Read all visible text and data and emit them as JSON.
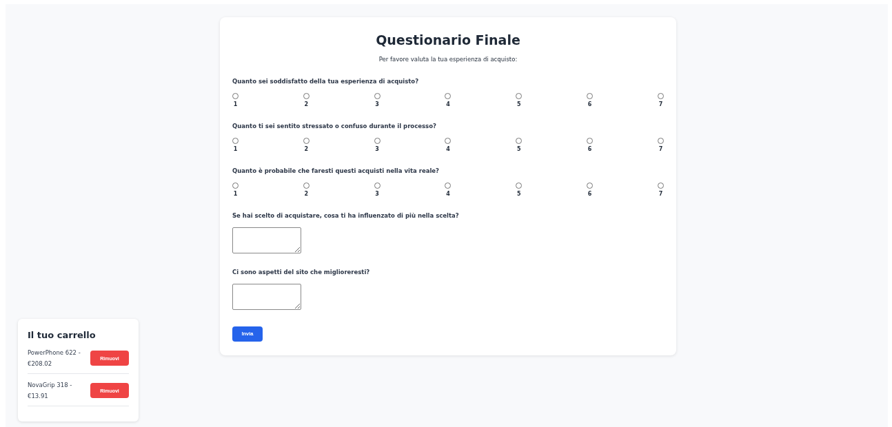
{
  "survey": {
    "title": "Questionario Finale",
    "intro": "Per favore valuta la tua esperienza di acquisto:",
    "questions": [
      {
        "kind": "scale",
        "label": "Quanto sei soddisfatto della tua esperienza di acquisto?",
        "options": [
          {
            "label": "1",
            "selected": false
          },
          {
            "label": "2",
            "selected": false
          },
          {
            "label": "3",
            "selected": false
          },
          {
            "label": "4",
            "selected": false
          },
          {
            "label": "5",
            "selected": false
          },
          {
            "label": "6",
            "selected": false
          },
          {
            "label": "7",
            "selected": false
          }
        ]
      },
      {
        "kind": "scale",
        "label": "Quanto ti sei sentito stressato o confuso durante il processo?",
        "options": [
          {
            "label": "1",
            "selected": false
          },
          {
            "label": "2",
            "selected": false
          },
          {
            "label": "3",
            "selected": false
          },
          {
            "label": "4",
            "selected": false
          },
          {
            "label": "5",
            "selected": false
          },
          {
            "label": "6",
            "selected": false
          },
          {
            "label": "7",
            "selected": false
          }
        ]
      },
      {
        "kind": "scale",
        "label": "Quanto è probabile che faresti questi acquisti nella vita reale?",
        "options": [
          {
            "label": "1",
            "selected": false
          },
          {
            "label": "2",
            "selected": false
          },
          {
            "label": "3",
            "selected": false
          },
          {
            "label": "4",
            "selected": false
          },
          {
            "label": "5",
            "selected": false
          },
          {
            "label": "6",
            "selected": false
          },
          {
            "label": "7",
            "selected": false
          }
        ]
      },
      {
        "kind": "text",
        "label": "Se hai scelto di acquistare, cosa ti ha influenzato di più nella scelta?"
      },
      {
        "kind": "text",
        "label": "Ci sono aspetti del sito che miglioreresti?"
      }
    ],
    "submit": "Invia"
  },
  "cart": {
    "title": "Il tuo carrello",
    "items": [
      {
        "name": "PowerPhone 622 -",
        "price": "€208.02",
        "button": "Rimuovi"
      },
      {
        "name": "NovaGrip 318 -",
        "price": "€13.91",
        "button": "Rimuovi"
      }
    ]
  }
}
